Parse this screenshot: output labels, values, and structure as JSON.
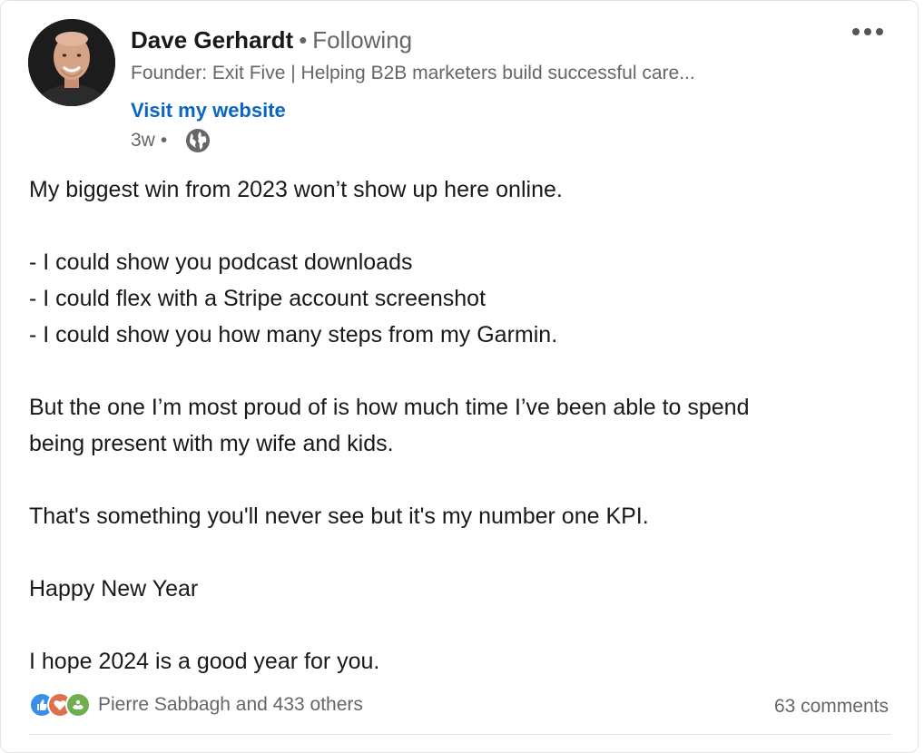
{
  "post": {
    "author": {
      "name": "Dave Gerhardt",
      "separator": "•",
      "follow_status": "Following",
      "headline": "Founder: Exit Five | Helping B2B marketers build successful care...",
      "website_link": "Visit my website",
      "time_ago": "3w",
      "meta_separator": "•"
    },
    "body": {
      "p1": "My biggest win from 2023 won’t show up here online.",
      "list": [
        "- I could show you podcast downloads",
        "- I could flex with a Stripe account screenshot",
        "- I could show you how many steps from my Garmin."
      ],
      "p2_line1": "But the one I’m most proud of is how much time I’ve been able to spend",
      "p2_line2": "being present with my wife and kids.",
      "p3": "That's something you'll never see but it's my number one KPI.",
      "p4": "Happy New Year",
      "p5": "I hope 2024 is a good year for you."
    },
    "social": {
      "reactions_text": "Pierre Sabbagh and 433 others",
      "comments_text": "63 comments"
    }
  },
  "icons": {
    "globe": "globe-icon",
    "more": "ellipsis-icon",
    "like": "like-icon",
    "love": "love-icon",
    "support": "support-icon"
  },
  "colors": {
    "link": "#0a66c2",
    "text": "#191919",
    "muted": "#666666",
    "like": "#378fe9",
    "love": "#df704d",
    "support": "#6dae4f"
  }
}
